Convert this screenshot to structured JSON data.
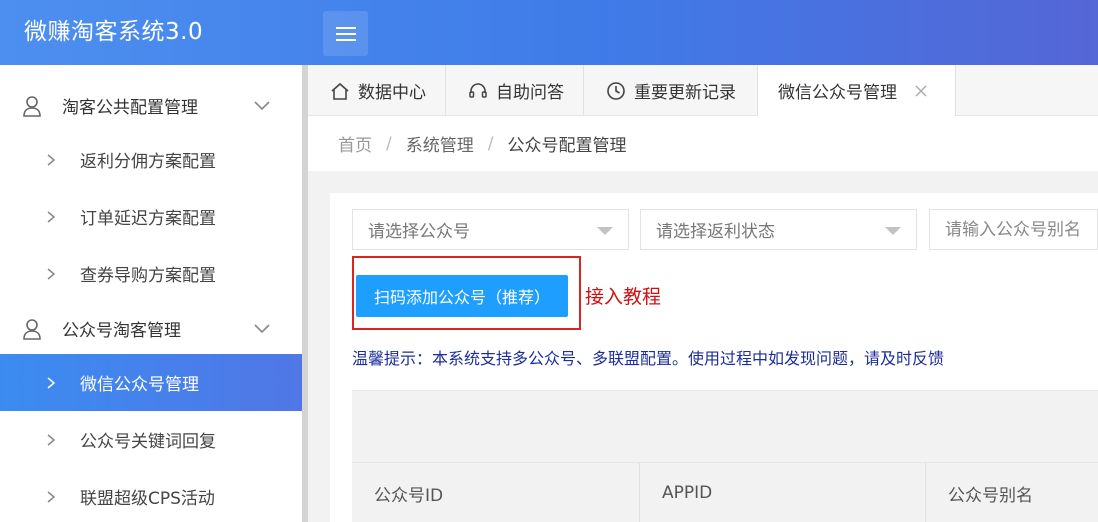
{
  "header": {
    "brand": "微赚淘客系统3.0"
  },
  "sidebar": {
    "groups": [
      {
        "label": "淘客公共配置管理"
      },
      {
        "label": "公众号淘客管理"
      }
    ],
    "items": [
      {
        "label": "返利分佣方案配置"
      },
      {
        "label": "订单延迟方案配置"
      },
      {
        "label": "查券导购方案配置"
      },
      {
        "label": "微信公众号管理"
      },
      {
        "label": "公众号关键词回复"
      },
      {
        "label": "联盟超级CPS活动"
      }
    ]
  },
  "tabs": [
    {
      "label": "数据中心",
      "icon": "home-icon"
    },
    {
      "label": "自助问答",
      "icon": "headset-icon"
    },
    {
      "label": "重要更新记录",
      "icon": "clock-icon"
    },
    {
      "label": "微信公众号管理",
      "icon": "close-icon"
    }
  ],
  "breadcrumb": {
    "home": "首页",
    "section": "系统管理",
    "page": "公众号配置管理"
  },
  "filters": {
    "account_select": "请选择公众号",
    "rebate_select": "请选择返利状态",
    "alias_placeholder": "请输入公众号别名"
  },
  "actions": {
    "scan_add": "扫码添加公众号（推荐）",
    "tutorial": "接入教程"
  },
  "tip": "温馨提示：本系统支持多公众号、多联盟配置。使用过程中如发现问题，请及时反馈",
  "table": {
    "columns": [
      "公众号ID",
      "APPID",
      "公众号别名"
    ]
  },
  "colors": {
    "accent": "#1e9fff",
    "active_menu": "#4a82ec",
    "tutorial": "#d01010",
    "tip": "#1c2e9a"
  }
}
